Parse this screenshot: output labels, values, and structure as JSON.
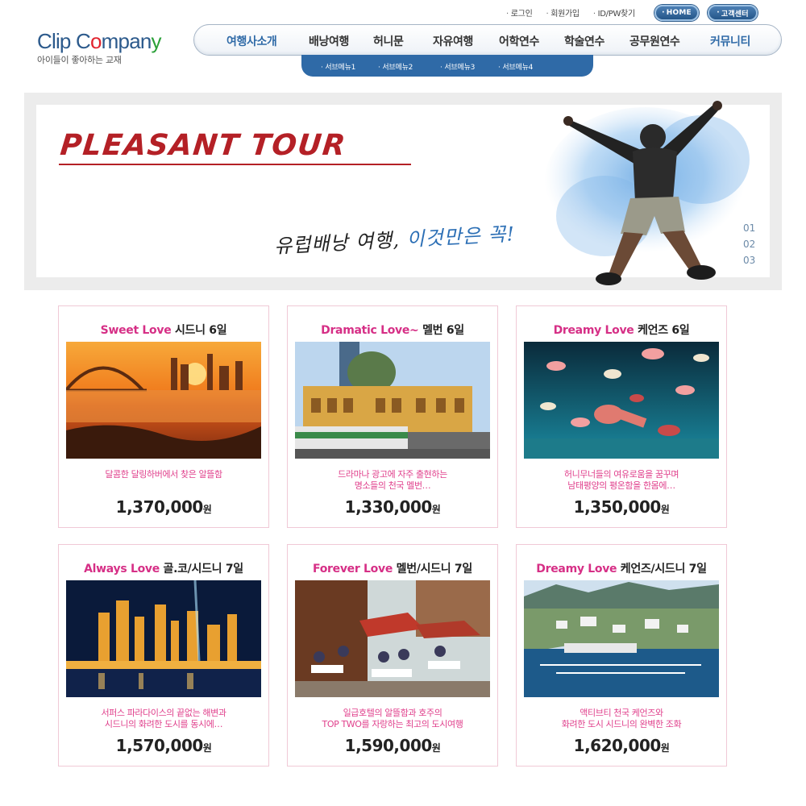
{
  "util_links": [
    "로그인",
    "회원가입",
    "ID/PW찾기"
  ],
  "util_buttons": {
    "home": "HOME",
    "support": "고객센터"
  },
  "logo": {
    "part1": "Clip C",
    "o1": "o",
    "part2": "mpan",
    "o3": "y",
    "tagline": "아이들이 좋아하는 교재"
  },
  "nav": {
    "items": [
      "여행사소개",
      "배낭여행",
      "허니문",
      "자유여행",
      "어학연수",
      "학술연수",
      "공무원연수",
      "커뮤니티"
    ],
    "sub_items": [
      "서브메뉴1",
      "서브메뉴2",
      "서브메뉴3",
      "서브메뉴4"
    ]
  },
  "hero": {
    "title": "PLEASANT TOUR",
    "subtitle_black": "유럽배낭 여행,",
    "subtitle_blue": "이것만은 꼭!",
    "indicators": [
      "01",
      "02",
      "03"
    ]
  },
  "products": [
    {
      "name": "Sweet Love",
      "dest": "시드니",
      "days": "6일",
      "desc": [
        "달콤한 달링하버에서 찾은 알뜰함"
      ],
      "price": "1,370,000",
      "unit": "원",
      "scene": "harbour-sunset"
    },
    {
      "name": "Dramatic Love~",
      "dest": "멜번",
      "days": "6일",
      "desc": [
        "드라마나 광고에 자주 출현하는",
        "명소들의 천국 멜번…"
      ],
      "price": "1,330,000",
      "unit": "원",
      "scene": "station"
    },
    {
      "name": "Dreamy Love",
      "dest": "케언즈",
      "days": "6일",
      "desc": [
        "허니무너들의 여유로움을 꿈꾸며",
        "남태평양의 평온함을 한몸에…"
      ],
      "price": "1,350,000",
      "unit": "원",
      "scene": "reef"
    },
    {
      "name": "Always Love",
      "dest": "골.코/시드니",
      "days": "7일",
      "desc": [
        "서퍼스 파라다이스의 끝없는 해변과",
        "시드니의 화려한 도시를 동시에…"
      ],
      "price": "1,570,000",
      "unit": "원",
      "scene": "night-city"
    },
    {
      "name": "Forever Love",
      "dest": "멜번/시드니",
      "days": "7일",
      "desc": [
        "일급호텔의 알뜰함과 호주의",
        "TOP TWO를 자랑하는 최고의 도시여행"
      ],
      "price": "1,590,000",
      "unit": "원",
      "scene": "cafe"
    },
    {
      "name": "Dreamy Love",
      "dest": "케언즈/시드니",
      "days": "7일",
      "desc": [
        "액티브티 천국 케언즈와",
        "화려한 도시 시드니의 완벽한 조화"
      ],
      "price": "1,620,000",
      "unit": "원",
      "scene": "coast"
    }
  ],
  "colors": {
    "brand_blue": "#2f6aa7",
    "pink": "#d62f86",
    "hero_red": "#b42026"
  }
}
